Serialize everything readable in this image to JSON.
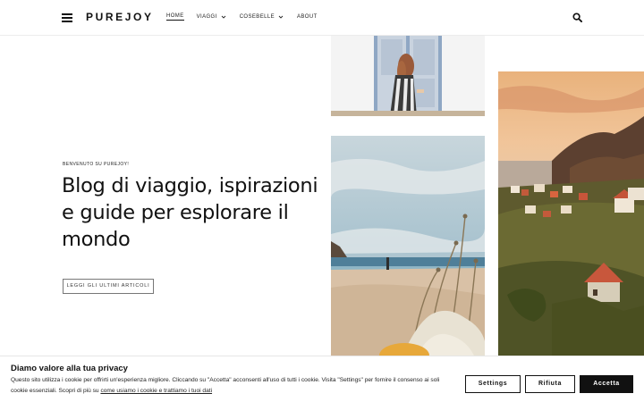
{
  "header": {
    "logo": "PUREJOY",
    "nav": [
      {
        "label": "HOME",
        "active": true,
        "has_dropdown": false
      },
      {
        "label": "VIAGGI",
        "active": false,
        "has_dropdown": true
      },
      {
        "label": "COSEBELLE",
        "active": false,
        "has_dropdown": true
      },
      {
        "label": "ABOUT",
        "active": false,
        "has_dropdown": false
      }
    ],
    "menu_icon": "hamburger-icon",
    "search_icon": "search-icon"
  },
  "hero": {
    "eyebrow": "BENVENUTO SU PUREJOY!",
    "headline": "Blog di viaggio, ispirazioni e guide per esplorare il mondo",
    "cta_label": "LEGGI GLI ULTIMI ARTICOLI"
  },
  "cookie_banner": {
    "title": "Diamo valore alla tua privacy",
    "text": "Questo sito utilizza i cookie per offrirti un'esperienza migliore. Cliccando su \"Accetta\" acconsenti all'uso di tutti i cookie. Visita \"Settings\" per fornire il consenso ai soli cookie essenziali. Scopri di più su ",
    "link_text": "come usiamo i cookie e trattiamo i tuoi dati",
    "buttons": {
      "settings": "Settings",
      "reject": "Rifiuta",
      "accept": "Accetta"
    }
  },
  "colors": {
    "text": "#111111",
    "accent_button": "#111111",
    "background": "#ffffff"
  }
}
